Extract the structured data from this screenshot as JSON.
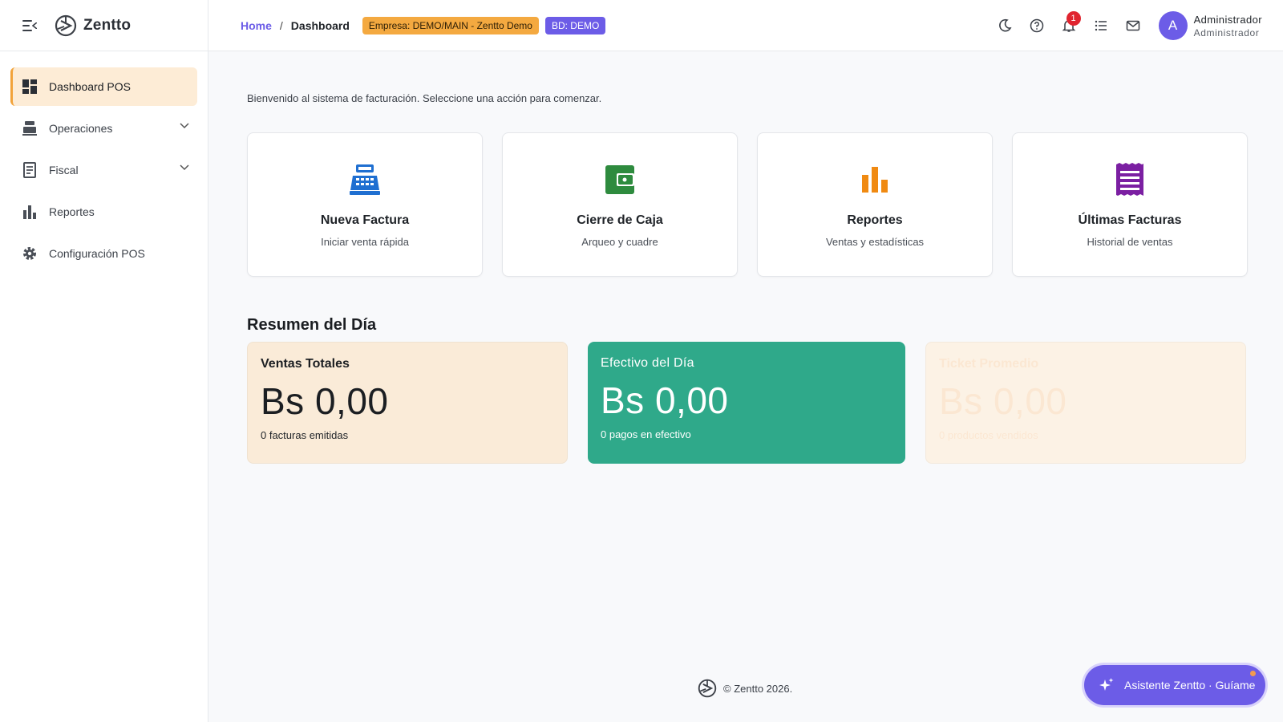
{
  "app": {
    "name": "Zentto"
  },
  "sidebar": {
    "items": [
      {
        "label": "Dashboard POS",
        "icon": "dashboard-icon"
      },
      {
        "label": "Operaciones",
        "icon": "cash-register-icon"
      },
      {
        "label": "Fiscal",
        "icon": "receipt-icon"
      },
      {
        "label": "Reportes",
        "icon": "bar-chart-icon"
      },
      {
        "label": "Configuración POS",
        "icon": "gear-icon"
      }
    ]
  },
  "header": {
    "breadcrumb_home": "Home",
    "breadcrumb_sep": "/",
    "breadcrumb_current": "Dashboard",
    "badge_empresa": "Empresa: DEMO/MAIN - Zentto Demo",
    "badge_bd": "BD: DEMO",
    "notifications_count": "1",
    "user_initial": "A",
    "user_name": "Administrador",
    "user_role": "Administrador"
  },
  "main": {
    "welcome": "Bienvenido al sistema de facturación. Seleccione una acción para comenzar.",
    "cards": [
      {
        "title": "Nueva Factura",
        "subtitle": "Iniciar venta rápida",
        "icon": "cash-register-icon",
        "color": "#1f6fd1"
      },
      {
        "title": "Cierre de Caja",
        "subtitle": "Arqueo y cuadre",
        "icon": "wallet-icon",
        "color": "#2e8b3e"
      },
      {
        "title": "Reportes",
        "subtitle": "Ventas y estadísticas",
        "icon": "bar-chart-icon",
        "color": "#f08a12"
      },
      {
        "title": "Últimas Facturas",
        "subtitle": "Historial de ventas",
        "icon": "receipt-icon",
        "color": "#7b1fa2"
      }
    ],
    "summary_title": "Resumen del Día",
    "stats": [
      {
        "label": "Ventas Totales",
        "value": "Bs 0,00",
        "foot": "0 facturas emitidas"
      },
      {
        "label": "Efectivo del Día",
        "value": "Bs 0,00",
        "foot": "0 pagos en efectivo"
      },
      {
        "label": "Ticket Promedio",
        "value": "Bs 0,00",
        "foot": "0 productos vendidos"
      }
    ]
  },
  "footer": {
    "text": "© Zentto 2026."
  },
  "assistant": {
    "label": "Asistente Zentto · Guíame"
  }
}
